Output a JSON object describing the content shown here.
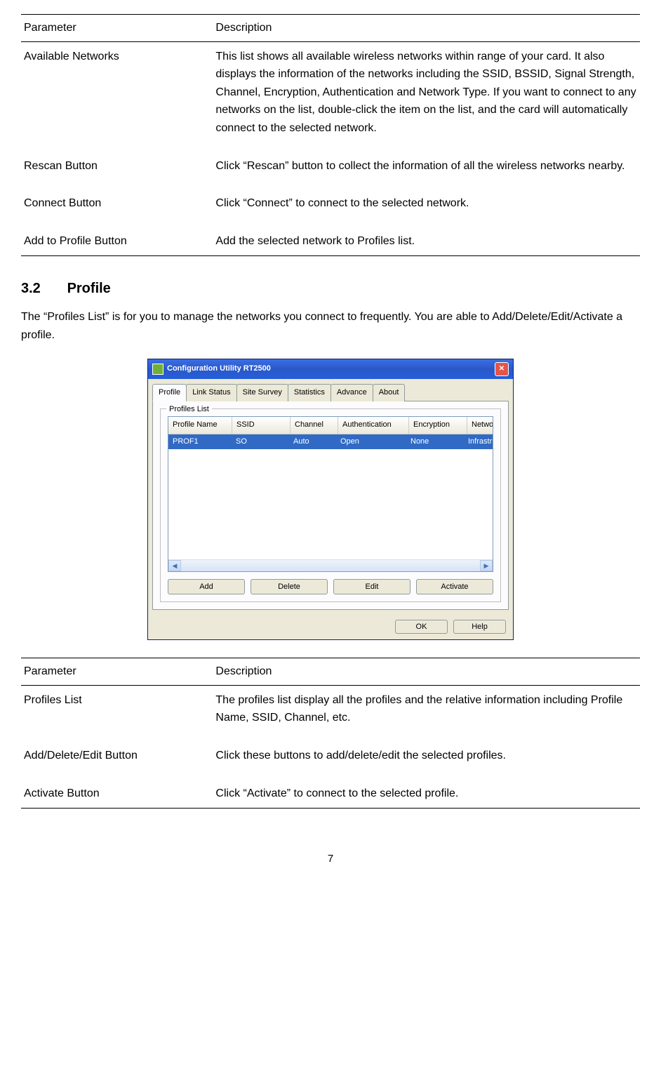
{
  "table1": {
    "headers": {
      "param": "Parameter",
      "desc": "Description"
    },
    "rows": [
      {
        "param": "Available Networks",
        "desc": "This list shows all available wireless networks within range of your card. It also displays the information of the networks including the SSID, BSSID, Signal Strength, Channel, Encryption, Authentication and Network Type. If you want to connect to any networks on the list, double-click the item on the list, and the card will automatically connect to the selected network."
      },
      {
        "param": "Rescan Button",
        "desc": "Click “Rescan” button to collect the information of all the wireless networks nearby."
      },
      {
        "param": "Connect Button",
        "desc": "Click “Connect” to connect to the selected network."
      },
      {
        "param": "Add to Profile Button",
        "desc": "Add the selected network to Profiles list."
      }
    ]
  },
  "section": {
    "number": "3.2",
    "title": "Profile",
    "intro": "The “Profiles List” is for you to manage the networks you connect to frequently. You are able to Add/Delete/Edit/Activate a profile."
  },
  "window": {
    "title": "Configuration Utility RT2500",
    "tabs": [
      "Profile",
      "Link Status",
      "Site Survey",
      "Statistics",
      "Advance",
      "About"
    ],
    "active_tab": 0,
    "groupbox": "Profiles List",
    "columns": {
      "profile": "Profile Name",
      "ssid": "SSID",
      "channel": "Channel",
      "auth": "Authentication",
      "enc": "Encryption",
      "net": "Network Type"
    },
    "row": {
      "profile": "PROF1",
      "ssid": "SO",
      "channel": "Auto",
      "auth": "Open",
      "enc": "None",
      "net": "Infrastrucure"
    },
    "buttons": {
      "add": "Add",
      "delete": "Delete",
      "edit": "Edit",
      "activate": "Activate"
    },
    "dialog": {
      "ok": "OK",
      "help": "Help"
    }
  },
  "table2": {
    "headers": {
      "param": "Parameter",
      "desc": "Description"
    },
    "rows": [
      {
        "param": "Profiles List",
        "desc": "The profiles list display all the profiles and the relative information including Profile Name, SSID, Channel, etc."
      },
      {
        "param": "Add/Delete/Edit Button",
        "desc": "Click these buttons to add/delete/edit the selected profiles."
      },
      {
        "param": "Activate Button",
        "desc": "Click “Activate” to connect to the selected profile."
      }
    ]
  },
  "page_number": "7"
}
